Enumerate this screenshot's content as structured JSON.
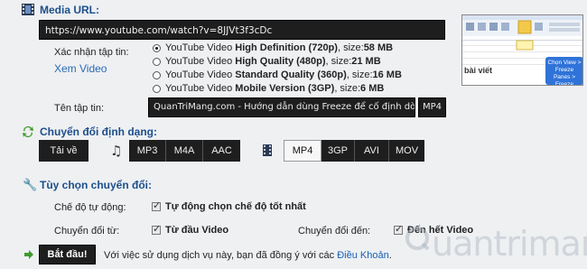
{
  "media_url": {
    "title": "Media URL:",
    "value": "https://www.youtube.com/watch?v=8JJVt3f3cDc"
  },
  "quality": {
    "confirm_label": "Xác nhận tập tin:",
    "watch_link": "Xem Video",
    "options": [
      {
        "prefix": "YouTube Video ",
        "bold": "High Definition (720p)",
        "size_label": ", size: ",
        "size": "58 MB",
        "selected": true
      },
      {
        "prefix": "YouTube Video ",
        "bold": "High Quality (480p)",
        "size_label": ", size: ",
        "size": "21 MB",
        "selected": false
      },
      {
        "prefix": "YouTube Video ",
        "bold": "Standard Quality (360p)",
        "size_label": ", size: ",
        "size": "16 MB",
        "selected": false
      },
      {
        "prefix": "YouTube Video ",
        "bold": "Mobile Version (3GP)",
        "size_label": ", size: ",
        "size": "6 MB",
        "selected": false
      }
    ]
  },
  "filename": {
    "label": "Tên tập tin:",
    "value": "QuanTriMang.com - Hướng dẫn dùng Freeze để cố định dòng, cột dữ",
    "ext": "MP4"
  },
  "format": {
    "title": "Chuyển đổi định dạng:",
    "download": "Tải về",
    "audio": [
      "MP3",
      "M4A",
      "AAC"
    ],
    "video": [
      "MP4",
      "3GP",
      "AVI",
      "MOV"
    ],
    "active_video": "MP4"
  },
  "options": {
    "title": "Tùy chọn chuyển đổi:",
    "auto_label": "Chế độ tự động:",
    "auto_value": "Tự động chọn chế độ tốt nhất",
    "from_label": "Chuyển đổi từ:",
    "from_value": "Từ đầu Video",
    "to_label": "Chuyển đổi đến:",
    "to_value": "Đến hết Video"
  },
  "footer": {
    "start_button": "Bắt đầu!",
    "agree_text": "Với việc sử dụng dịch vụ này, bạn đã đồng ý với các ",
    "terms_link": "Điều Khoản",
    "period": "."
  },
  "thumbnail": {
    "caption_left": "bài viết",
    "overlay_text": "Chọn View > Freeze Panes > Freeze Panes"
  },
  "watermark": "uantrimang",
  "colors": {
    "accent": "#1d4f8c",
    "dark_button": "#1e1e1e",
    "link": "#1a5fb4",
    "overlay_blue": "#2f73d9"
  }
}
